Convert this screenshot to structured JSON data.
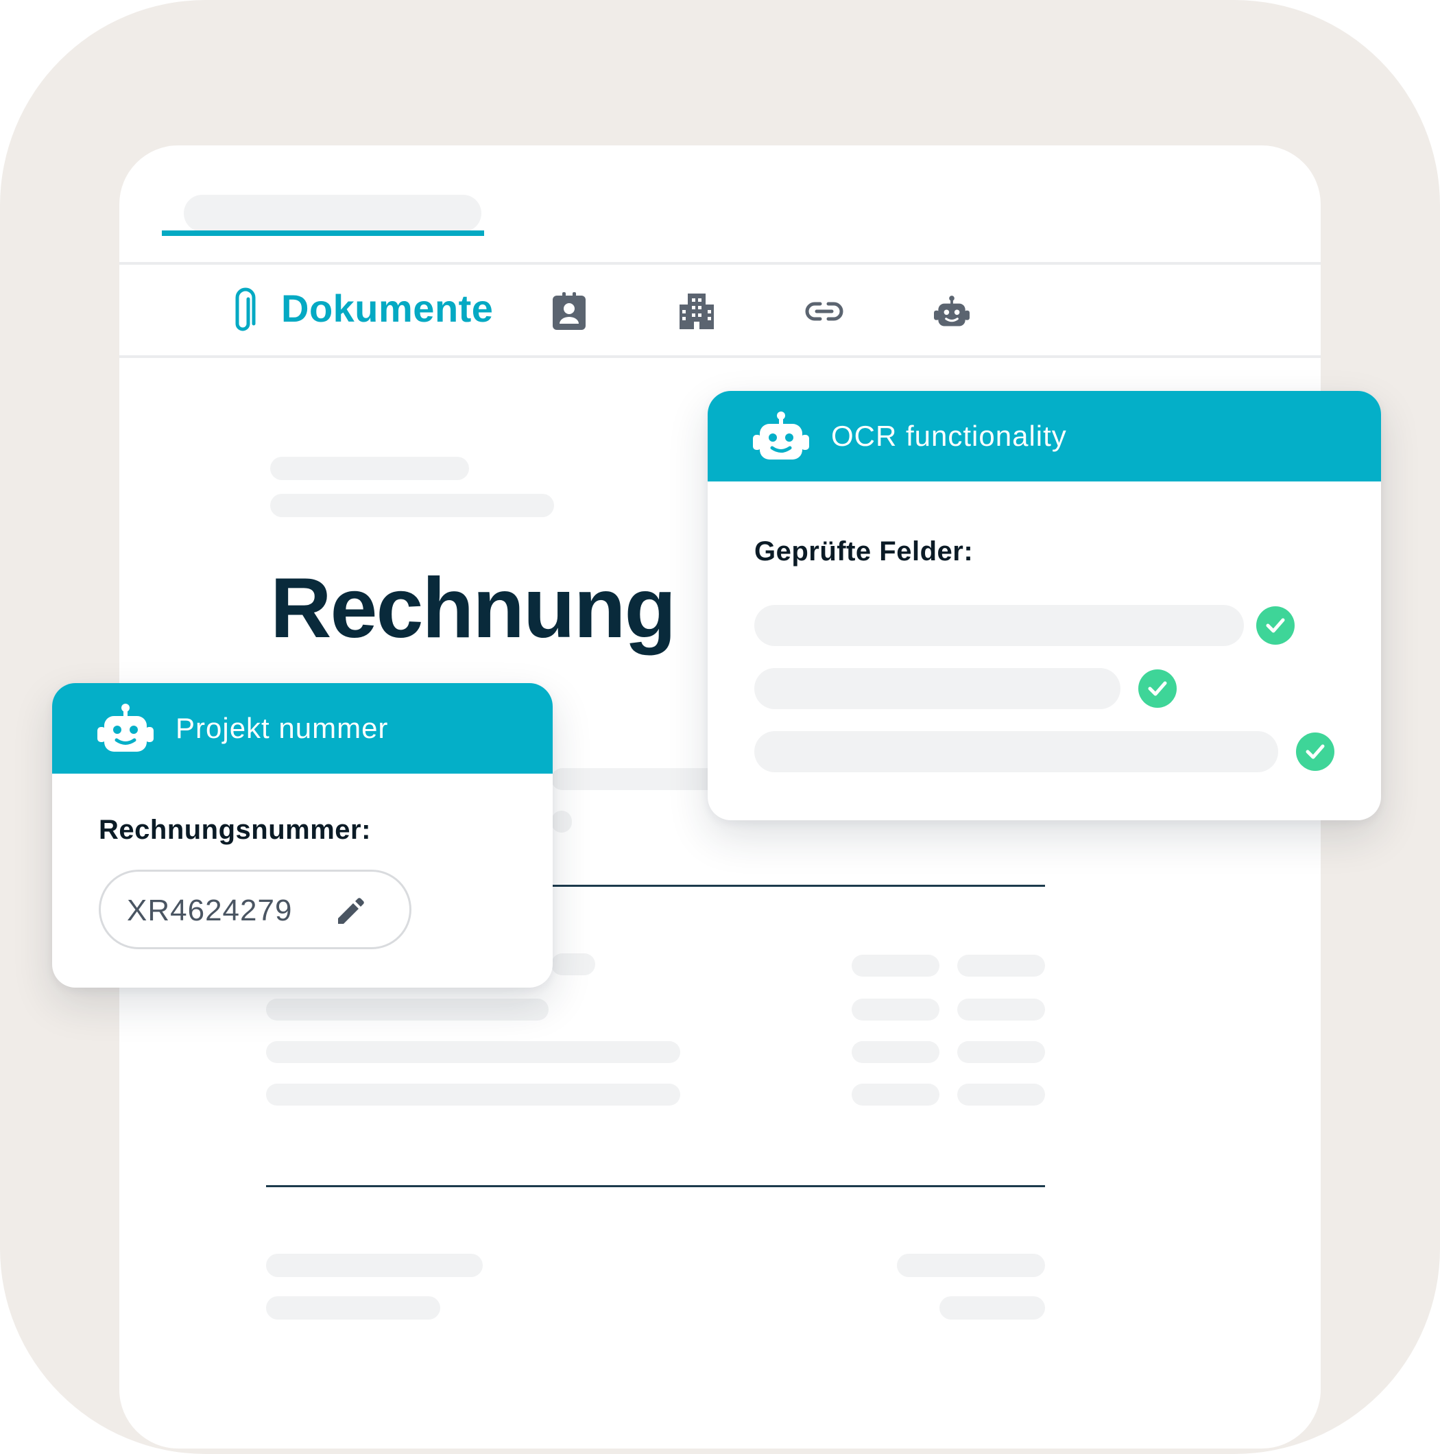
{
  "tabs": {
    "active_label": "Dokumente",
    "icons": [
      "paperclip-icon",
      "contact-card-icon",
      "building-icon",
      "link-icon",
      "robot-icon"
    ]
  },
  "document": {
    "heading": "Rechnung"
  },
  "ocr_card": {
    "title": "OCR functionality",
    "subtitle": "Geprüfte Felder:",
    "checked_fields": 3
  },
  "project_card": {
    "title": "Projekt nummer",
    "field_label": "Rechnungsnummer:",
    "field_value": "XR4624279"
  },
  "colors": {
    "accent": "#04a9c3",
    "header": "#04afc8",
    "check": "#3ed598",
    "heading": "#092a3b",
    "background": "#f0ece8"
  }
}
